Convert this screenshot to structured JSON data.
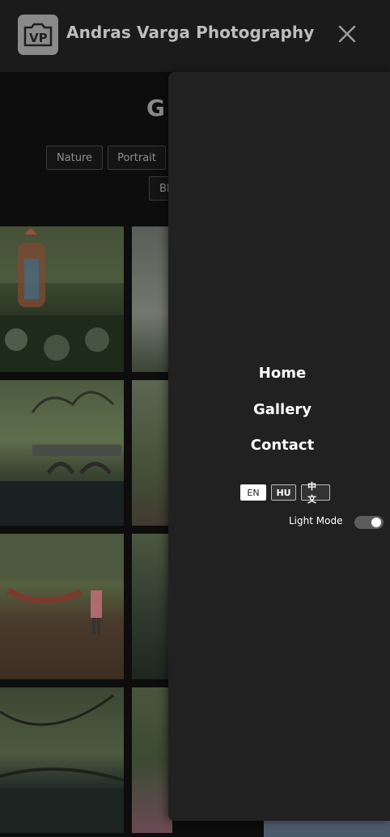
{
  "header": {
    "site_title": "Andras Varga Photography",
    "logo_text": "VP",
    "close_icon": "close-icon"
  },
  "page": {
    "heading": "G",
    "filters": [
      "Nature",
      "Portrait",
      "Bl"
    ]
  },
  "drawer": {
    "nav": [
      "Home",
      "Gallery",
      "Contact"
    ],
    "languages": [
      {
        "label": "EN",
        "active": true
      },
      {
        "label": "HU",
        "active": false
      },
      {
        "label": "中文",
        "active": false
      }
    ],
    "mode_label": "Light Mode",
    "mode_on": true
  }
}
